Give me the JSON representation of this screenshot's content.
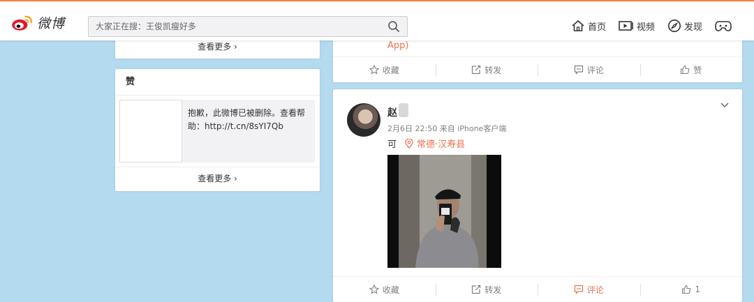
{
  "header": {
    "logo_text": "微博",
    "search_placeholder": "大家正在搜：王俊凯瘦好多",
    "nav": [
      {
        "label": "首页",
        "icon": "home-icon"
      },
      {
        "label": "视频",
        "icon": "video-icon"
      },
      {
        "label": "发现",
        "icon": "compass-icon"
      }
    ]
  },
  "left": {
    "top_more": "查看更多 ›",
    "likes_title": "赞",
    "likes_message": "抱歉，此微博已被删除。查看帮助：http://t.cn/8sYI7Qb",
    "likes_more": "查看更多 ›"
  },
  "feed_top": {
    "app_text": "App)",
    "actions": [
      "收藏",
      "转发",
      "评论",
      "赞"
    ]
  },
  "post": {
    "username": "赵",
    "meta": "2月6日 22:50 来自 iPhone客户端",
    "text": "可",
    "location": "常德·汉寿县",
    "actions": [
      "收藏",
      "转发",
      "评论",
      "1"
    ]
  },
  "colors": {
    "accent": "#eb7350",
    "bg": "#b3daee",
    "brand_top": "#fa7d3c"
  }
}
